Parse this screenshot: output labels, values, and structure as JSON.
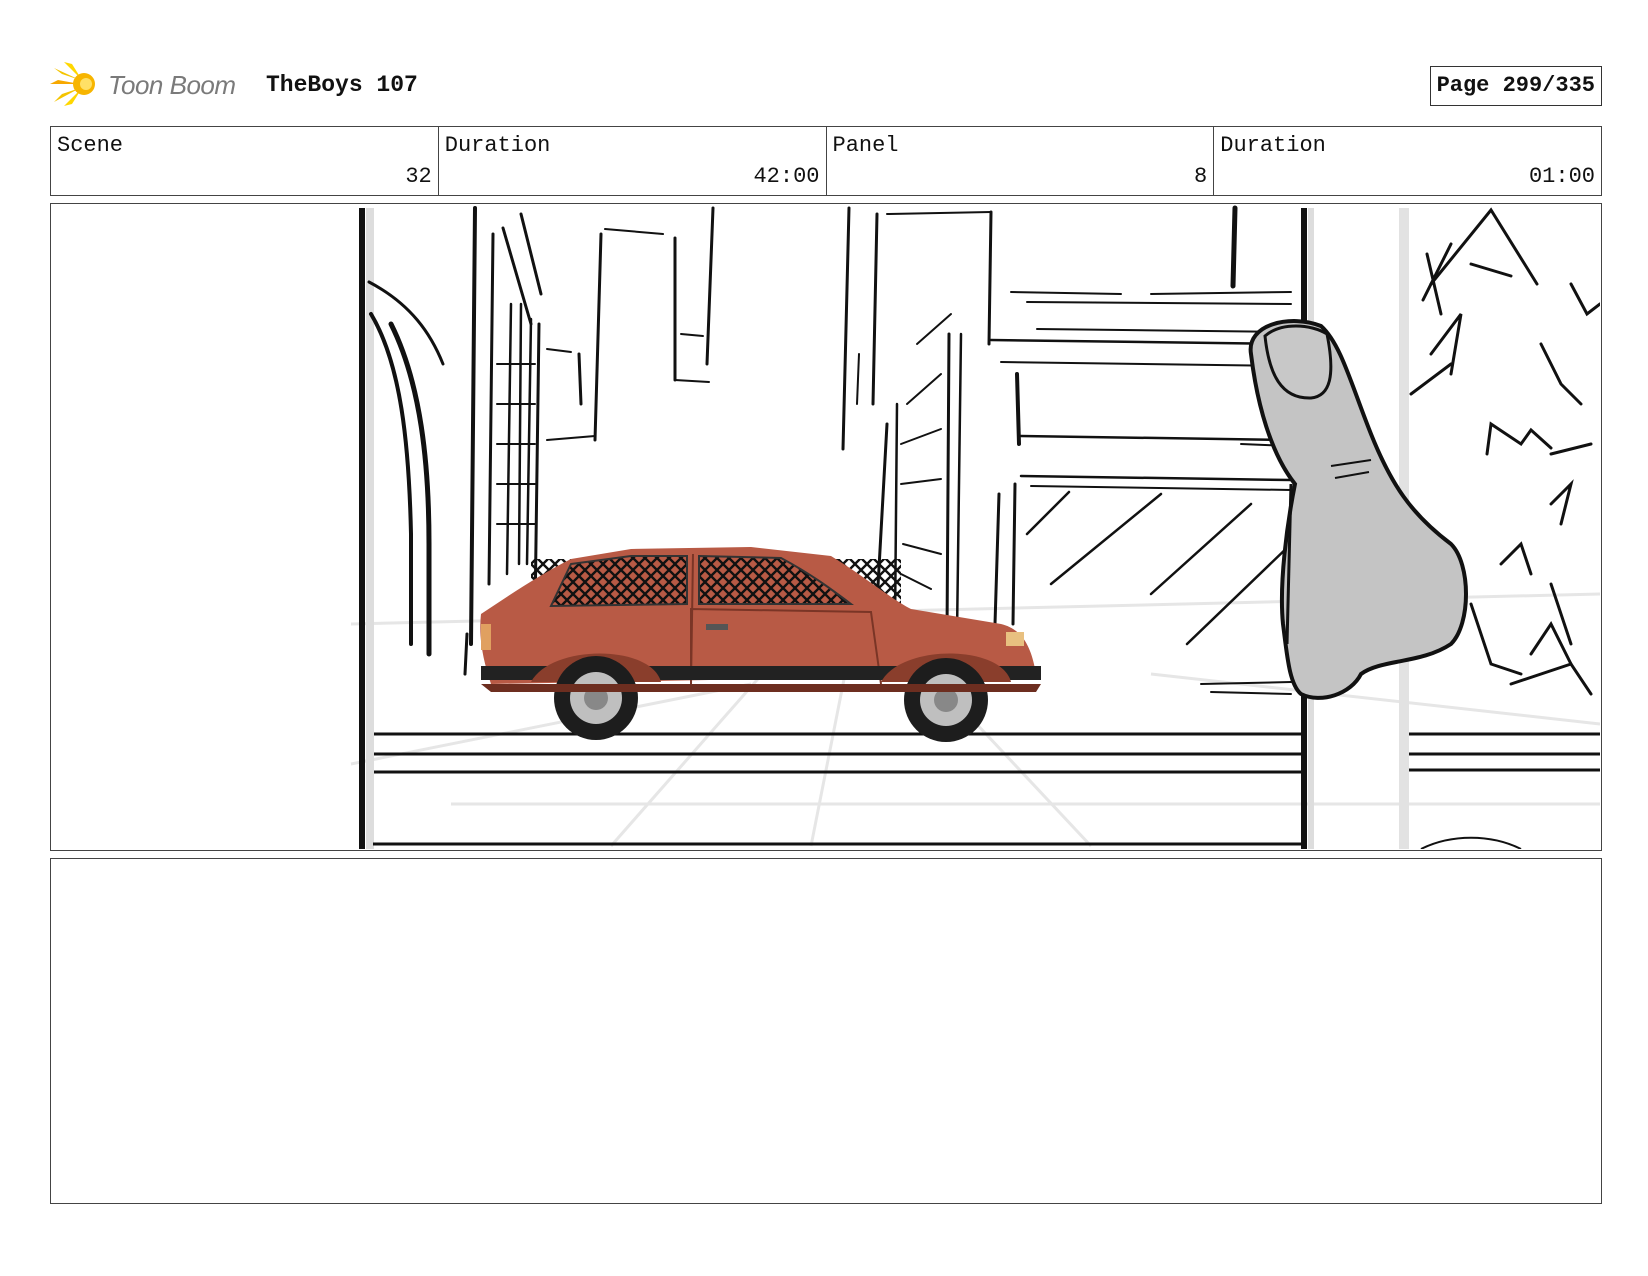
{
  "header": {
    "logo_text": "Toon Boom",
    "project_title": "TheBoys 107",
    "page_label": "Page 299/335"
  },
  "info": {
    "scene_label": "Scene",
    "scene_value": "32",
    "scene_duration_label": "Duration",
    "scene_duration_value": "42:00",
    "panel_label": "Panel",
    "panel_value": "8",
    "panel_duration_label": "Duration",
    "panel_duration_value": "01:00"
  },
  "panel_art": {
    "car_color": "#b85a45",
    "finger_color": "#c4c4c4"
  },
  "notes": {
    "text": ""
  }
}
